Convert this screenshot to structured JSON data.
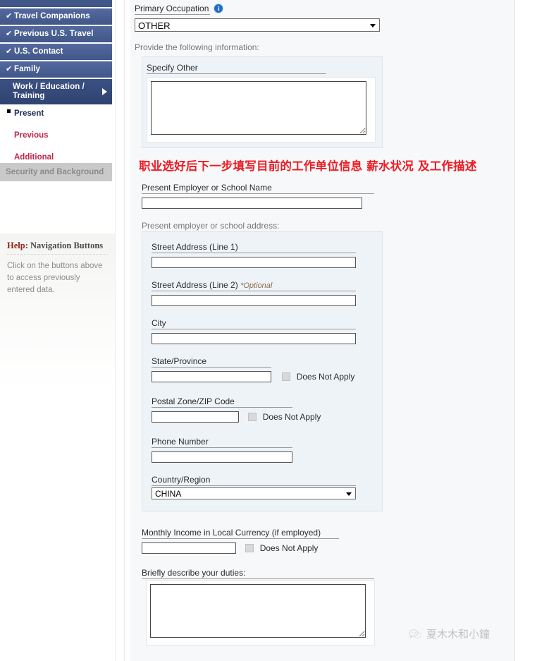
{
  "sidebar": {
    "nav_items": [
      {
        "label": "",
        "check": "",
        "state": "partial"
      },
      {
        "label": "Travel Companions",
        "check": "✔",
        "state": "done"
      },
      {
        "label": "Previous U.S. Travel",
        "check": "✔",
        "state": "done"
      },
      {
        "label": "U.S. Contact",
        "check": "✔",
        "state": "done"
      },
      {
        "label": "Family",
        "check": "✔",
        "state": "done"
      },
      {
        "label": "Work / Education / Training",
        "check": "",
        "state": "active"
      }
    ],
    "sub_items": [
      {
        "label": "Present",
        "state": "current"
      },
      {
        "label": "Previous",
        "state": "link"
      },
      {
        "label": "Additional",
        "state": "link"
      }
    ],
    "disabled_item": {
      "label": "Security and Background"
    },
    "help": {
      "title_highlight": "Help",
      "title_rest": ": Navigation Buttons",
      "body": "Click on the buttons above to access previously entered data."
    }
  },
  "form": {
    "primary_occupation": {
      "label": "Primary Occupation",
      "info_icon_glyph": "i",
      "value": "OTHER"
    },
    "provide_info_text": "Provide the following information:",
    "specify_other": {
      "label": "Specify Other",
      "value": ""
    },
    "employer_name": {
      "label": "Present Employer or School Name",
      "value": ""
    },
    "address_section_label": "Present employer or school address:",
    "street1": {
      "label": "Street Address (Line 1)",
      "value": ""
    },
    "street2": {
      "label": "Street Address (Line 2)",
      "optional": "*Optional",
      "value": ""
    },
    "city": {
      "label": "City",
      "value": ""
    },
    "state_province": {
      "label": "State/Province",
      "value": "",
      "does_not_apply_label": "Does Not Apply",
      "does_not_apply_checked": false
    },
    "postal_code": {
      "label": "Postal Zone/ZIP Code",
      "value": "",
      "does_not_apply_label": "Does Not Apply",
      "does_not_apply_checked": false
    },
    "phone": {
      "label": "Phone Number",
      "value": ""
    },
    "country": {
      "label": "Country/Region",
      "value": "CHINA"
    },
    "monthly_income": {
      "label": "Monthly Income in Local Currency (if employed)",
      "value": "",
      "does_not_apply_label": "Does Not Apply",
      "does_not_apply_checked": false
    },
    "duties": {
      "label": "Briefly describe your duties:",
      "value": ""
    }
  },
  "annotation": {
    "text": "职业选好后下一步填写目前的工作单位信息  薪水状况  及工作描述",
    "color": "#ee1c25"
  },
  "watermark": {
    "text": "夏木木和小鐘"
  },
  "colors": {
    "nav_blue": "#4a5f96",
    "nav_active": "#35497c",
    "link_red": "#c0264c",
    "panel_blue": "#eef3f8",
    "content_bg": "#f7f8f9"
  }
}
